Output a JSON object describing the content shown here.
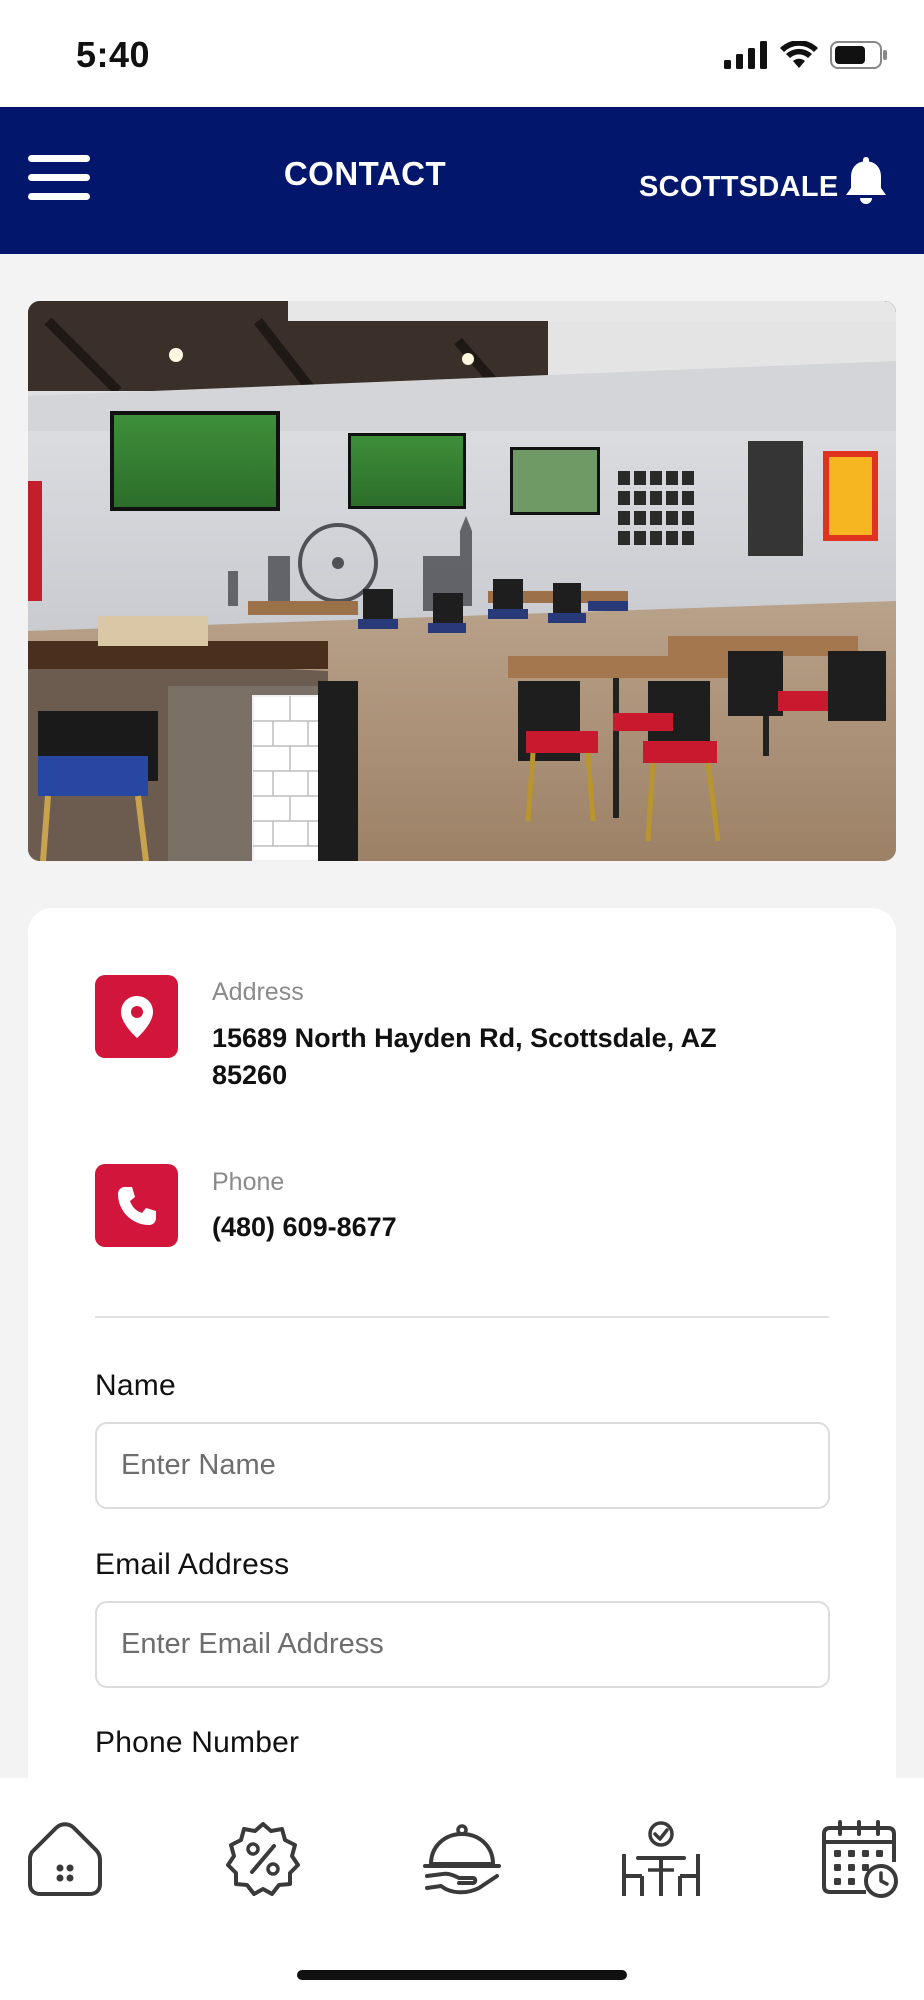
{
  "status_bar": {
    "time": "5:40",
    "icons": [
      "cellular-signal-icon",
      "wifi-icon",
      "battery-icon"
    ]
  },
  "header": {
    "title": "CONTACT",
    "location": "SCOTTSDALE",
    "menu_icon": "hamburger-menu-icon",
    "notification_icon": "bell-icon",
    "background_color": "#02166b"
  },
  "hero": {
    "image": "restaurant-interior-photo"
  },
  "contact": {
    "address_label": "Address",
    "address_line1": "15689 North Hayden Rd, Scottsdale, AZ",
    "address_line2": "85260",
    "phone_label": "Phone",
    "phone_value": "(480) 609-8677",
    "icon_color": "#d2163b"
  },
  "form": {
    "name_label": "Name",
    "name_placeholder": "Enter Name",
    "email_label": "Email Address",
    "email_placeholder": "Enter Email Address",
    "phone_label": "Phone Number"
  },
  "bottom_nav": {
    "items": [
      {
        "icon": "home-icon"
      },
      {
        "icon": "discount-badge-icon"
      },
      {
        "icon": "food-cloche-icon"
      },
      {
        "icon": "reservation-table-icon"
      },
      {
        "icon": "calendar-clock-icon"
      }
    ]
  }
}
